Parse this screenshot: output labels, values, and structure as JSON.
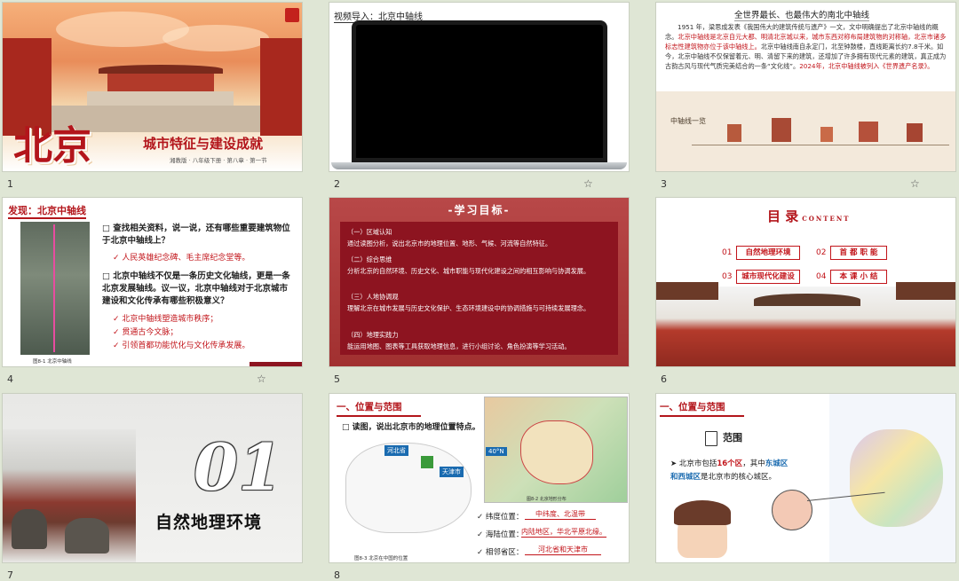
{
  "slides": [
    {
      "num": "1",
      "title": "北京",
      "subtitle": "城市特征与建设成就",
      "caption": "湘教版 · 八年级下册 · 第八章 · 第一节"
    },
    {
      "num": "2",
      "heading": "视频导入：北京中轴线",
      "starred": true
    },
    {
      "num": "3",
      "heading": "全世界最长、也最伟大的南北中轴线",
      "body_black_1": "1951 年，梁思成发表《我国伟大的建筑传统与遗产》一文，文中明确提出了北京中轴线的概念。",
      "body_red_1": "北京中轴线是北京自元大都、明清北京城以来，城市东西对称布局建筑物的对称轴，北京市诸多标志性建筑物亦位于该中轴线上。",
      "body_black_2": "北京中轴线南自永定门，北至钟鼓楼，直线距离长约7.8千米。如今，北京中轴线不仅保留着元、明、清留下来的建筑，还增加了许多拥有现代元素的建筑，真正成为古韵古风与现代气质完美结合的一条“文化线”。",
      "body_red_2": "2024年，北京中轴线被列入《世界遗产名录》。",
      "strip_label": "中轴线一览",
      "starred": true
    },
    {
      "num": "4",
      "heading": "发现：北京中轴线",
      "q1": "查找相关资料，说一说，还有哪些重要建筑物位于北京中轴线上？",
      "a1": "人民英雄纪念碑、毛主席纪念堂等。",
      "q2": "北京中轴线不仅是一条历史文化轴线，更是一条北京发展轴线。议一议，北京中轴线对于北京城市建设和文化传承有哪些积极意义？",
      "a2": [
        "北京中轴线塑造城市秩序；",
        "贯通古今文脉；",
        "引领首都功能优化与文化传承发展。"
      ],
      "map_caption": "图8-1  北京中轴线",
      "starred": true
    },
    {
      "num": "5",
      "heading": "-学习目标-",
      "goals": [
        {
          "h": "（一）区域认知",
          "t": "通过读图分析，说出北京市的地理位置、地形、气候、河流等自然特征。"
        },
        {
          "h": "（二）综合思维",
          "t": "分析北京的自然环境、历史文化、城市职能与现代化建设之间的相互影响与协调发展。"
        },
        {
          "h": "（三）人地协调观",
          "t": "理解北京在城市发展与历史文化保护、生态环境建设中的协调措施与可持续发展理念。"
        },
        {
          "h": "（四）地理实践力",
          "t": "能运用地图、图表等工具获取地理信息，进行小组讨论、角色扮演等学习活动。"
        }
      ]
    },
    {
      "num": "6",
      "heading": "目 录",
      "heading_en": "CONTENT",
      "items": [
        {
          "n": "01",
          "t": "自然地理环境"
        },
        {
          "n": "02",
          "t": "首 都 职 能"
        },
        {
          "n": "03",
          "t": "城市现代化建设"
        },
        {
          "n": "04",
          "t": "本 课 小 结"
        }
      ]
    },
    {
      "num": "7",
      "big_num": "01",
      "title": "自然地理环境"
    },
    {
      "num": "8",
      "section": "一、位置与范围",
      "prompt": "读图，说出北京市的地理位置特点。",
      "labels": {
        "hebei": "河北省",
        "tianjin": "天津市",
        "lat": "40°N"
      },
      "rows": [
        {
          "k": "纬度位置：",
          "v": "中纬度、北温带"
        },
        {
          "k": "海陆位置：",
          "v": "内陆地区，华北平原北缘。"
        },
        {
          "k": "相邻省区：",
          "v": "河北省和天津市"
        }
      ],
      "cap_left": "图8-3  北京在中国的位置",
      "cap_right": "图8-2  北京地形分布"
    },
    {
      "num": "9",
      "section": "一、位置与范围",
      "sub": "范围",
      "p_a": "北京市包括",
      "p_b": "16个区",
      "p_c": "，其中",
      "p_d": "东城区",
      "p_e": "和",
      "p_f": "西城区",
      "p_g": "是北京市的核心城区。"
    }
  ],
  "colors": {
    "accent": "#b3151b",
    "panel": "#8d1420",
    "bg": "#dfe6d5"
  }
}
